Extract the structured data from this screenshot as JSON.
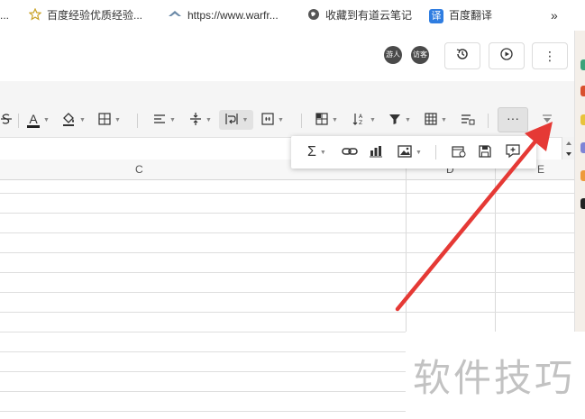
{
  "bookmarks": [
    {
      "label": "..."
    },
    {
      "label": "百度经验优质经验..."
    },
    {
      "label": "https://www.warfr..."
    },
    {
      "label": "收藏到有道云笔记"
    },
    {
      "label": "百度翻译",
      "badge": "译"
    },
    {
      "label": "»"
    }
  ],
  "header": {
    "avatar1": "游人",
    "avatar2": "访客",
    "more": "⋮"
  },
  "toolbar": {
    "font_color_letter": "A",
    "more_label": "···"
  },
  "popup": {
    "sum_symbol": "Σ"
  },
  "columns": {
    "c": "C",
    "d": "D",
    "e": "E"
  },
  "watermark": "软件技巧",
  "colors": {
    "arrow": "#e53935",
    "toolbar_bg": "#f5f5f5",
    "font_underline": "#222222"
  }
}
